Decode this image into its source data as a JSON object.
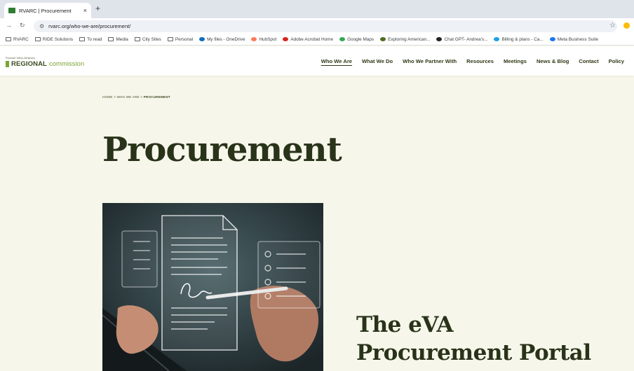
{
  "browser": {
    "tab_title": "RVARC | Procurement",
    "tab_close": "×",
    "new_tab": "+",
    "url": "rvarc.org/who-we-are/procurement/",
    "bookmarks": [
      {
        "label": "RVARC",
        "icon": "folder-icon"
      },
      {
        "label": "RIDE Solutions",
        "icon": "folder-icon"
      },
      {
        "label": "To read",
        "icon": "folder-icon"
      },
      {
        "label": "Media",
        "icon": "folder-icon"
      },
      {
        "label": "City Sites",
        "icon": "folder-icon"
      },
      {
        "label": "Personal",
        "icon": "folder-icon"
      },
      {
        "label": "My files - OneDrive",
        "icon": "onedrive-icon",
        "color": "#0f6cbd"
      },
      {
        "label": "HubSpot",
        "icon": "hubspot-icon",
        "color": "#ff7a59"
      },
      {
        "label": "Adobe Acrobat Home",
        "icon": "acrobat-icon",
        "color": "#d9251d"
      },
      {
        "label": "Google Maps",
        "icon": "maps-icon",
        "color": "#34a853"
      },
      {
        "label": "Exploring American...",
        "icon": "site-icon",
        "color": "#4f6d1f"
      },
      {
        "label": "Chat GPT- Andrea's...",
        "icon": "chatgpt-icon",
        "color": "#202124"
      },
      {
        "label": "Billing & plans - Ca...",
        "icon": "canva-icon",
        "color": "#1aa0e6"
      },
      {
        "label": "Meta Business Suite",
        "icon": "meta-icon",
        "color": "#1877f2"
      }
    ]
  },
  "site": {
    "logo_small": "Roanoke Valley-Alleghany",
    "logo_main": "REGIONAL",
    "logo_accent": "commission",
    "nav": [
      "Who We Are",
      "What We Do",
      "Who We Partner With",
      "Resources",
      "Meetings",
      "News & Blog",
      "Contact",
      "Policy"
    ],
    "active_nav": "Who We Are",
    "breadcrumb": {
      "home": "HOME",
      "sep1": " > ",
      "parent": "WHO WE ARE",
      "sep2": " > ",
      "current": "PROCUREMENT"
    },
    "page_title": "Procurement",
    "section_title_line1": "The eVA",
    "section_title_line2": "Procurement Portal"
  },
  "colors": {
    "brand_dark": "#29331a",
    "brand_green": "#7aa536",
    "page_bg": "#f6f7ea"
  }
}
